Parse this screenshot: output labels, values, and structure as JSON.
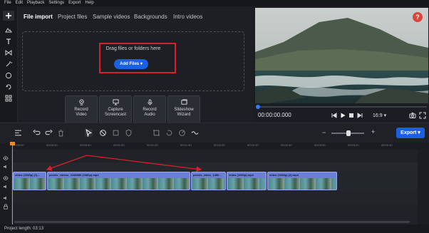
{
  "menu": [
    "File",
    "Edit",
    "Playback",
    "Settings",
    "Export",
    "Help"
  ],
  "tools": [
    "add-icon",
    "media-icon",
    "text-icon",
    "transitions-icon",
    "effects-icon",
    "stickers-icon",
    "overlay-icon",
    "templates-icon"
  ],
  "tabs": [
    {
      "label": "File import",
      "active": true
    },
    {
      "label": "Project files",
      "active": false
    },
    {
      "label": "Sample videos",
      "active": false
    },
    {
      "label": "Backgrounds",
      "active": false
    },
    {
      "label": "Intro videos",
      "active": false
    }
  ],
  "dropzone": {
    "text": "Drag files or folders here",
    "add_button": "Add Files"
  },
  "quick_buttons": [
    {
      "line1": "Record",
      "line2": "Video",
      "icon": "webcam-icon"
    },
    {
      "line1": "Capture",
      "line2": "Screencast",
      "icon": "monitor-icon"
    },
    {
      "line1": "Record",
      "line2": "Audio",
      "icon": "microphone-icon"
    },
    {
      "line1": "Slideshow",
      "line2": "Wizard",
      "icon": "slideshow-icon"
    }
  ],
  "preview": {
    "help": "?",
    "timecode": "00:00:00.000",
    "aspect_ratio": "16:9",
    "progress_fraction": 0.0
  },
  "timeline": {
    "export_label": "Export",
    "ruler_ticks": [
      "00:00:00",
      "00:00:20",
      "00:00:40",
      "00:01:00",
      "00:01:20",
      "00:01:40",
      "00:02:00",
      "00:02:20",
      "00:02:40",
      "00:03:00",
      "00:03:20",
      "00:03:40"
    ],
    "clips": [
      {
        "name": "video (1080p) (1)..."
      },
      {
        "name": "pexels_videos_2168880 (1080p).mp4"
      },
      {
        "name": "pexels_video_1480..."
      },
      {
        "name": "video (1080p).mp4"
      },
      {
        "name": "video (1080p) (2).mp4"
      }
    ]
  },
  "status": {
    "project_length": "Project length: 03:13"
  },
  "colors": {
    "accent": "#1b5fe3",
    "clip": "#6b7fd8",
    "highlight": "#d9202a",
    "playhead": "#e8892a"
  }
}
